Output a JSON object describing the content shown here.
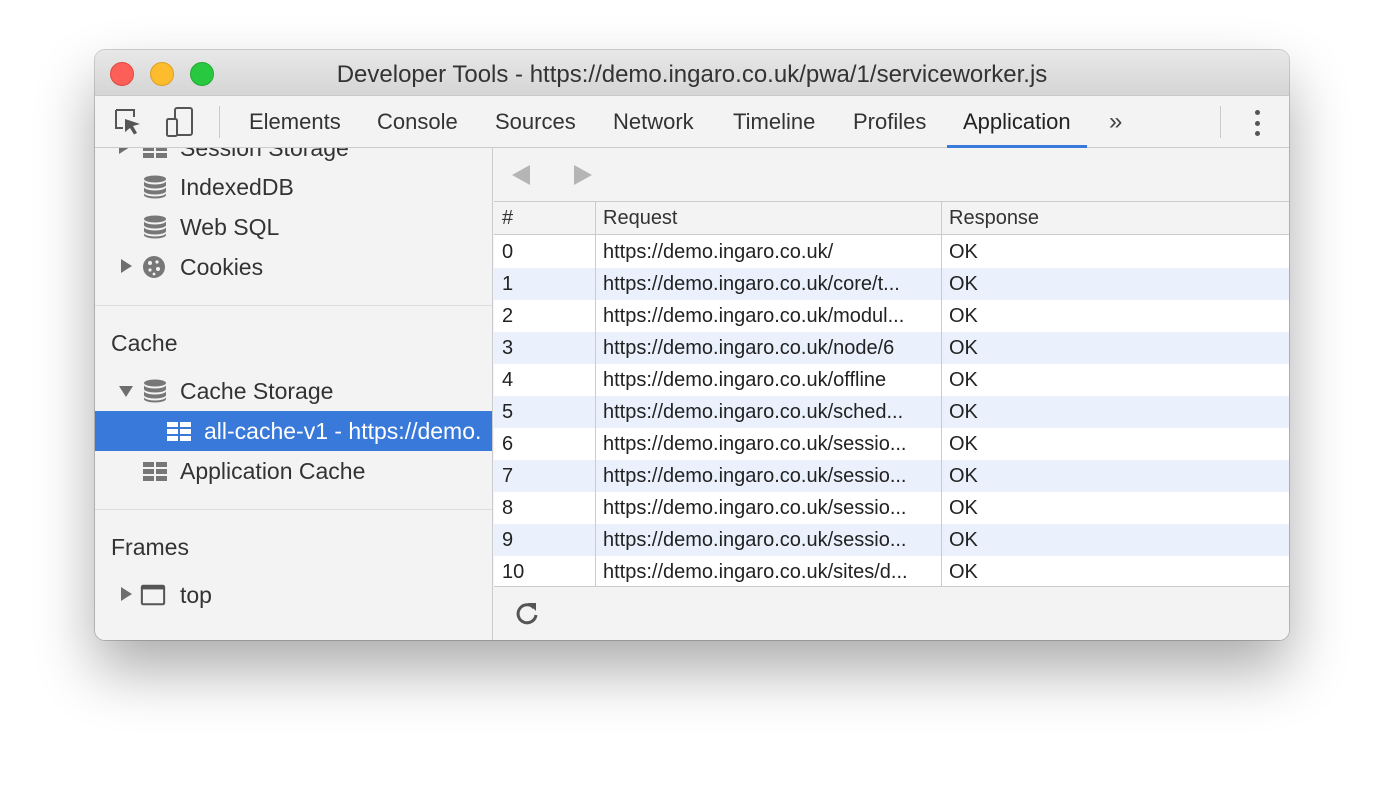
{
  "window": {
    "title": "Developer Tools - https://demo.ingaro.co.uk/pwa/1/serviceworker.js"
  },
  "toolbar": {
    "icons": [
      "inspect-element-icon",
      "device-toolbar-icon",
      "more-tabs-icon",
      "menu-kebab-icon"
    ],
    "tabs": [
      {
        "label": "Elements"
      },
      {
        "label": "Console"
      },
      {
        "label": "Sources"
      },
      {
        "label": "Network"
      },
      {
        "label": "Timeline"
      },
      {
        "label": "Profiles"
      },
      {
        "label": "Application",
        "active": true
      }
    ],
    "overflow": "»",
    "accent_color": "#3879d9"
  },
  "sidebar": {
    "storage_items": [
      {
        "label": "Session Storage",
        "icon": "grid-icon",
        "expandable": true
      },
      {
        "label": "IndexedDB",
        "icon": "database-icon"
      },
      {
        "label": "Web SQL",
        "icon": "database-icon"
      },
      {
        "label": "Cookies",
        "icon": "cookie-icon",
        "expandable": true
      }
    ],
    "cache_section": {
      "title": "Cache",
      "items": [
        {
          "label": "Cache Storage",
          "icon": "database-icon",
          "expanded": true
        },
        {
          "label": "all-cache-v1 - https://demo.",
          "icon": "grid-icon",
          "selected": true
        },
        {
          "label": "Application Cache",
          "icon": "grid-icon"
        }
      ]
    },
    "frames_section": {
      "title": "Frames",
      "items": [
        {
          "label": "top",
          "icon": "frame-icon",
          "expandable": true
        }
      ]
    },
    "selected_color": "#3879d9"
  },
  "cache_table": {
    "nav": {
      "prev_icon": "back-arrow-icon",
      "next_icon": "forward-arrow-icon"
    },
    "columns": [
      "#",
      "Request",
      "Response"
    ],
    "rows": [
      {
        "index": "0",
        "request": "https://demo.ingaro.co.uk/",
        "response": "OK"
      },
      {
        "index": "1",
        "request": "https://demo.ingaro.co.uk/core/t...",
        "response": "OK"
      },
      {
        "index": "2",
        "request": "https://demo.ingaro.co.uk/modul...",
        "response": "OK"
      },
      {
        "index": "3",
        "request": "https://demo.ingaro.co.uk/node/6",
        "response": "OK"
      },
      {
        "index": "4",
        "request": "https://demo.ingaro.co.uk/offline",
        "response": "OK"
      },
      {
        "index": "5",
        "request": "https://demo.ingaro.co.uk/sched...",
        "response": "OK"
      },
      {
        "index": "6",
        "request": "https://demo.ingaro.co.uk/sessio...",
        "response": "OK"
      },
      {
        "index": "7",
        "request": "https://demo.ingaro.co.uk/sessio...",
        "response": "OK"
      },
      {
        "index": "8",
        "request": "https://demo.ingaro.co.uk/sessio...",
        "response": "OK"
      },
      {
        "index": "9",
        "request": "https://demo.ingaro.co.uk/sessio...",
        "response": "OK"
      },
      {
        "index": "10",
        "request": "https://demo.ingaro.co.uk/sites/d...",
        "response": "OK"
      }
    ],
    "stripe_color": "#eaf1fc",
    "footer_icon": "refresh-icon"
  }
}
